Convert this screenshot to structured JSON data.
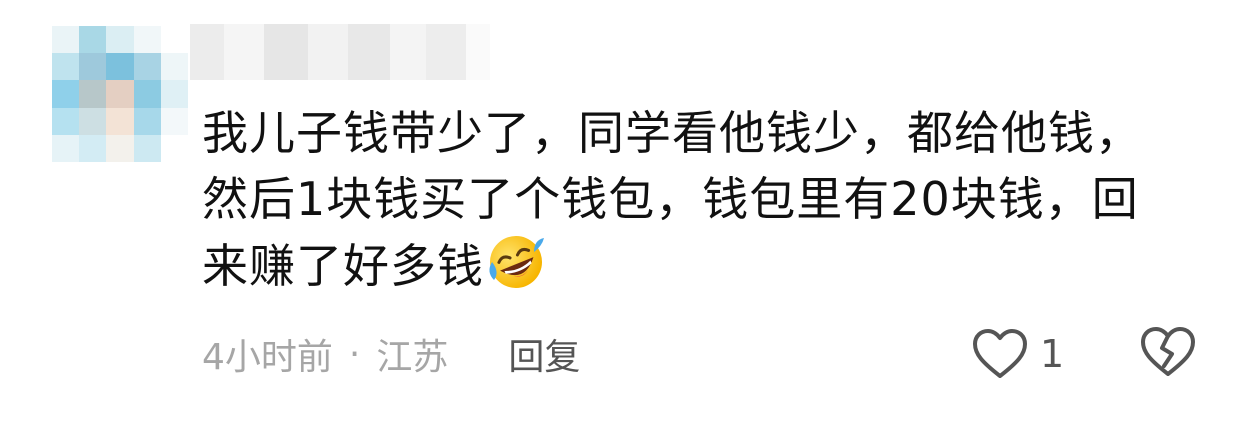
{
  "comment": {
    "lines": [
      "我儿子钱带少了，同学看他钱少，都给他钱，",
      "然后1块钱买了个钱包，钱包里有20块钱，回",
      "来赚了好多钱"
    ],
    "emoji": "rofl-emoji",
    "meta": {
      "time": "4小时前",
      "separator": "·",
      "location": "江苏",
      "reply_label": "回复"
    },
    "like": {
      "icon": "heart-outline-icon",
      "count": "1"
    },
    "dislike": {
      "icon": "broken-heart-icon"
    },
    "avatar": {
      "icon": "pixelated-avatar-icon"
    },
    "username": {
      "icon": "blurred-username"
    }
  }
}
